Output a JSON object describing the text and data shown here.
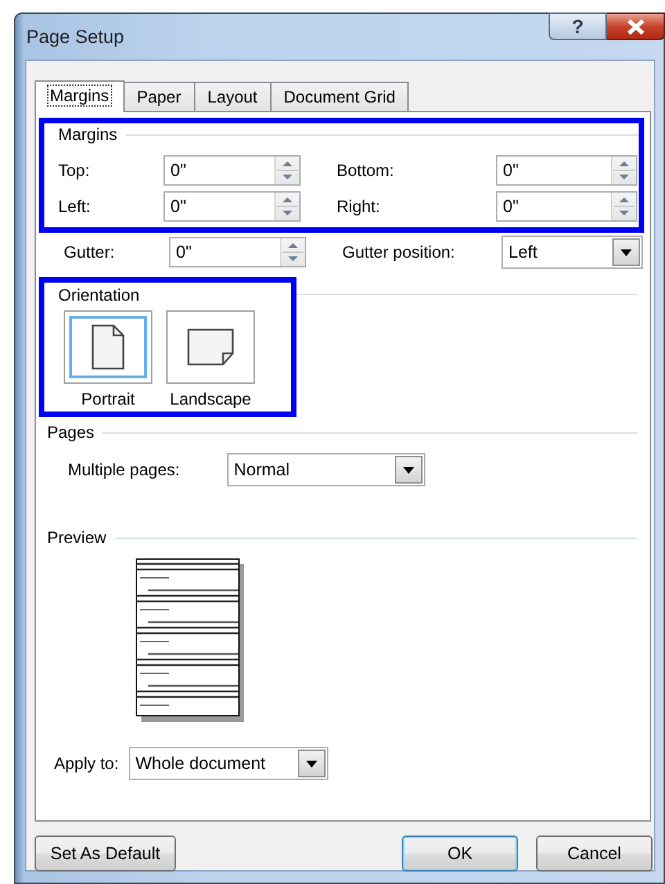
{
  "window": {
    "title": "Page Setup",
    "help_button": "?"
  },
  "tabs": [
    {
      "label": "Margins",
      "selected": true
    },
    {
      "label": "Paper",
      "selected": false
    },
    {
      "label": "Layout",
      "selected": false
    },
    {
      "label": "Document Grid",
      "selected": false
    }
  ],
  "margins": {
    "title": "Margins",
    "highlighted": true,
    "fields": [
      {
        "label": "Top:",
        "value": "0\""
      },
      {
        "label": "Bottom:",
        "value": "0\""
      },
      {
        "label": "Left:",
        "value": "0\""
      },
      {
        "label": "Right:",
        "value": "0\""
      }
    ],
    "gutter": {
      "label": "Gutter:",
      "value": "0\""
    },
    "gutter_position": {
      "label": "Gutter position:",
      "value": "Left"
    }
  },
  "orientation": {
    "title": "Orientation",
    "highlighted": true,
    "options": [
      {
        "label": "Portrait",
        "kind": "portrait",
        "selected": true
      },
      {
        "label": "Landscape",
        "kind": "landscape",
        "selected": false
      }
    ]
  },
  "pages": {
    "title": "Pages",
    "multiple_pages": {
      "label": "Multiple pages:",
      "value": "Normal"
    }
  },
  "preview": {
    "title": "Preview"
  },
  "apply_to": {
    "label": "Apply to:",
    "value": "Whole document"
  },
  "buttons": [
    {
      "label": "Set As Default",
      "default": false
    },
    {
      "label": "OK",
      "default": true
    },
    {
      "label": "Cancel",
      "default": false
    }
  ]
}
